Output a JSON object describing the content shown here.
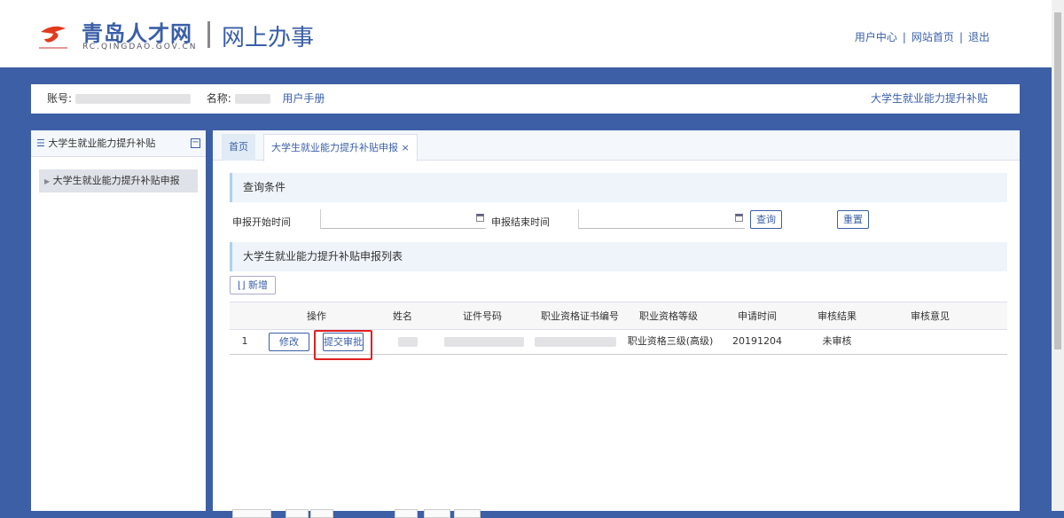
{
  "header": {
    "brand": "青岛人才网",
    "brand_sub": "RC.QINGDAO.GOV.CN",
    "slogan": "网上办事",
    "links": [
      "用户中心",
      "网站首页",
      "退出"
    ]
  },
  "info": {
    "account_label": "账号:",
    "name_label": "名称:",
    "manual": "用户手册",
    "module": "大学生就业能力提升补贴"
  },
  "sidebar": {
    "title": "大学生就业能力提升补贴",
    "items": [
      "大学生就业能力提升补贴申报"
    ]
  },
  "tabs": [
    {
      "label": "首页"
    },
    {
      "label": "大学生就业能力提升补贴申报 ×"
    }
  ],
  "query": {
    "title": "查询条件",
    "start_label": "申报开始时间",
    "end_label": "申报结束时间",
    "search": "查询",
    "reset": "重置"
  },
  "list": {
    "title": "大学生就业能力提升补贴申报列表",
    "add": "新增",
    "columns": [
      "操作",
      "姓名",
      "证件号码",
      "职业资格证书编号",
      "职业资格等级",
      "申请时间",
      "审核结果",
      "审核意见"
    ],
    "rows": [
      {
        "index": "1",
        "edit": "修改",
        "submit": "提交审批",
        "level": "职业资格三级(高级)",
        "date": "20191204",
        "status": "未审核",
        "opinion": ""
      }
    ]
  }
}
